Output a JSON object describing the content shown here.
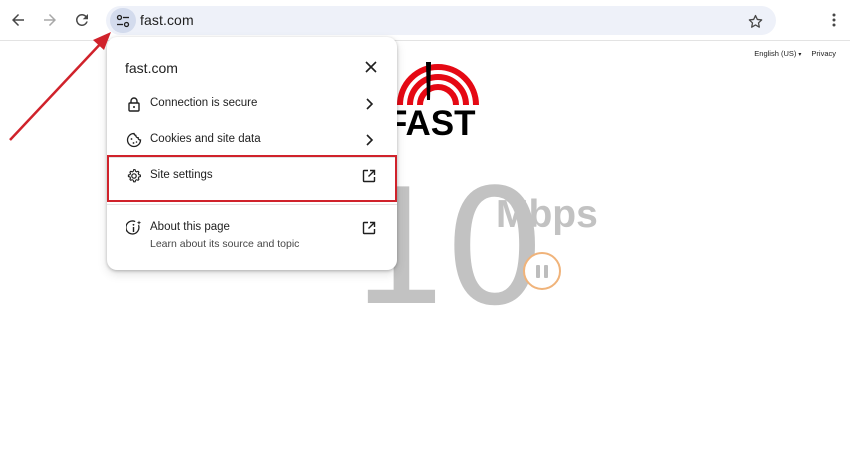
{
  "browser": {
    "url": "fast.com",
    "icons": {
      "back": "back-arrow-icon",
      "forward": "forward-arrow-icon",
      "reload": "reload-icon",
      "site_info": "tune-icon",
      "bookmark": "star-icon",
      "menu": "more-vert-icon"
    }
  },
  "page": {
    "top_links": {
      "language": "English (US)",
      "privacy": "Privacy"
    },
    "logo_text": "FAST",
    "speed": {
      "value": "10",
      "unit": "Mbps"
    },
    "colors": {
      "logo_red": "#e50914",
      "speed_gray": "#c2c2c2",
      "pause_ring": "#f0b37a"
    }
  },
  "site_info_popup": {
    "title": "fast.com",
    "items": [
      {
        "label": "Connection is secure",
        "icon": "lock-icon",
        "trailing": "chevron-right-icon"
      },
      {
        "label": "Cookies and site data",
        "icon": "cookie-icon",
        "trailing": "chevron-right-icon"
      },
      {
        "label": "Site settings",
        "icon": "gear-icon",
        "trailing": "open-in-new-icon"
      },
      {
        "label": "About this page",
        "sublabel": "Learn about its source and topic",
        "icon": "info-sparkle-icon",
        "trailing": "open-in-new-icon"
      }
    ]
  },
  "annotation": {
    "color": "#d0222b"
  }
}
